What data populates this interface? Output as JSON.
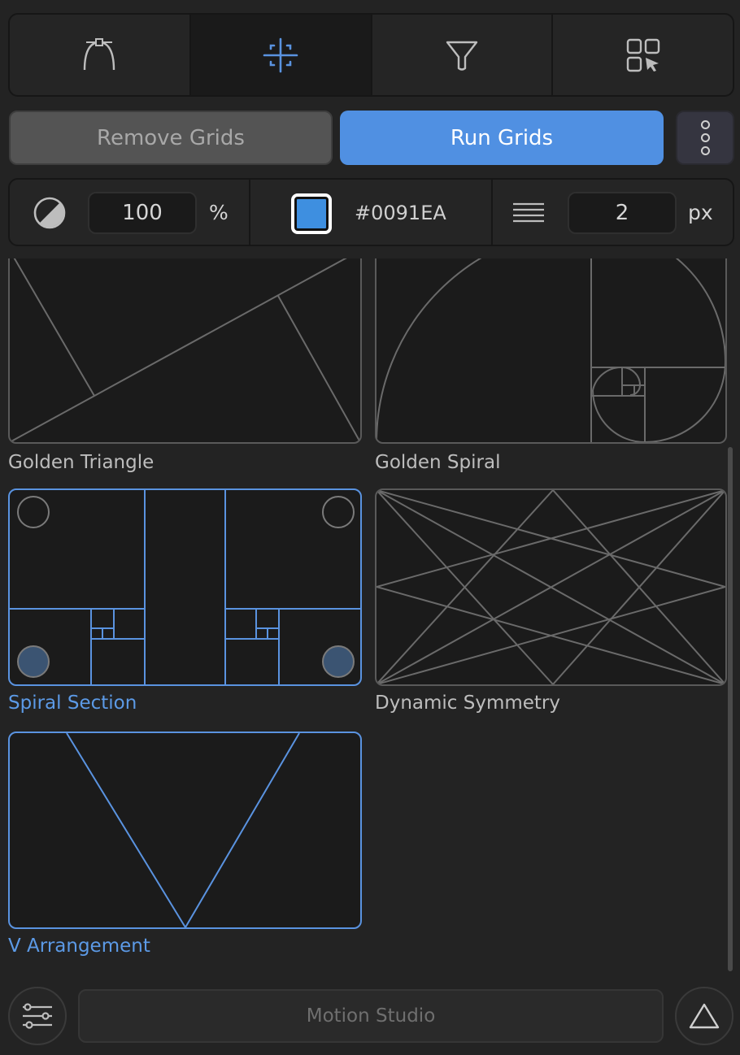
{
  "toolbar": {
    "tabs": [
      {
        "icon": "bezier-curve-icon",
        "active": false
      },
      {
        "icon": "grid-crosshair-icon",
        "active": true
      },
      {
        "icon": "funnel-icon",
        "active": false
      },
      {
        "icon": "widgets-cursor-icon",
        "active": false
      }
    ]
  },
  "actions": {
    "remove_label": "Remove Grids",
    "run_label": "Run Grids",
    "more_icon": "more-vertical-icon"
  },
  "settings": {
    "opacity_value": "100",
    "opacity_unit": "%",
    "color_hex": "#0091EA",
    "line_width_value": "2",
    "line_width_unit": "px"
  },
  "grids": [
    {
      "label": "Golden Triangle",
      "selected": false
    },
    {
      "label": "Golden Spiral",
      "selected": false
    },
    {
      "label": "Spiral Section",
      "selected": true
    },
    {
      "label": "Dynamic Symmetry",
      "selected": false
    },
    {
      "label": "V Arrangement",
      "selected": true
    }
  ],
  "footer": {
    "motion_label": "Motion Studio",
    "settings_icon": "sliders-icon",
    "triangle_icon": "triangle-icon"
  },
  "colors": {
    "accent": "#5090E2",
    "background": "#232323",
    "selected_stroke": "#5A93E0",
    "normal_stroke": "#6A6A6A"
  }
}
